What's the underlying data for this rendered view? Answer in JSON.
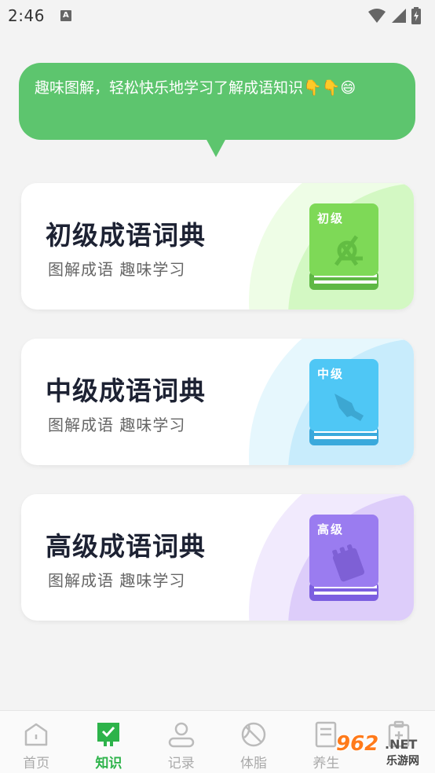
{
  "status_bar": {
    "time": "2:46",
    "notification_icon_letter": "A"
  },
  "bubble": {
    "text": "趣味图解，轻松快乐地学习了解成语知识👇👇😄"
  },
  "cards": [
    {
      "title": "初级成语词典",
      "subtitle": "图解成语 趣味学习",
      "book_label": "初级",
      "accent": "#7ed957",
      "bg_tint": "#dcfbcf",
      "icon": "compass-icon"
    },
    {
      "title": "中级成语词典",
      "subtitle": "图解成语 趣味学习",
      "book_label": "中级",
      "accent": "#4fc7f5",
      "bg_tint": "#cfeffd",
      "icon": "fountain-pen-icon"
    },
    {
      "title": "高级成语词典",
      "subtitle": "图解成语 趣味学习",
      "book_label": "高级",
      "accent": "#9a7cf0",
      "bg_tint": "#e3d6fb",
      "icon": "notepad-icon"
    }
  ],
  "bottom_nav": {
    "items": [
      {
        "label": "首页",
        "icon": "home-icon",
        "active": false
      },
      {
        "label": "知识",
        "icon": "knowledge-icon",
        "active": true
      },
      {
        "label": "记录",
        "icon": "user-record-icon",
        "active": false
      },
      {
        "label": "体脂",
        "icon": "ball-icon",
        "active": false
      },
      {
        "label": "养生",
        "icon": "document-icon",
        "active": false
      },
      {
        "label": "",
        "icon": "clipboard-plus-icon",
        "active": false
      }
    ]
  },
  "watermark": {
    "main": "962",
    "net": ".NET",
    "sub": "乐游网"
  },
  "colors": {
    "brand_green": "#5dc56e",
    "active_nav": "#2db34a"
  }
}
